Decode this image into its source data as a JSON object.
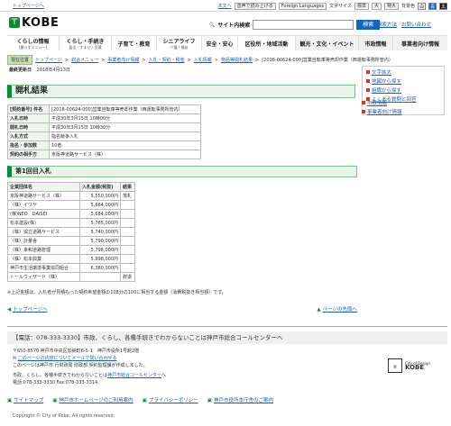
{
  "top": {
    "skip_link": "トップページへ",
    "tools": {
      "main_text": "本文へ",
      "read_aloud": "音声で読み上げる",
      "language": "Foreign Languages",
      "font_size_label": "文字サイズ",
      "font_normal": "標準",
      "font_large": "大",
      "font_xlarge": "特大",
      "bg_color_label": "背景色",
      "bg_white": "白",
      "bg_blue": "青",
      "bg_black": "黒"
    }
  },
  "logo": {
    "text": "KOBE"
  },
  "search": {
    "label": "サイト内検索",
    "placeholder": "",
    "button": "検索"
  },
  "header_links": {
    "search_help": "検索方法",
    "contact": "お問い合わせ"
  },
  "gnav": [
    {
      "title": "くらしの情報",
      "sub": "[暮らすメニュー]"
    },
    {
      "title": "くらし・手続き",
      "sub": "届出・すまい・交通"
    },
    {
      "title": "子育て・教育",
      "sub": ""
    },
    {
      "title": "シニアライフ",
      "sub": "介護・福祉"
    },
    {
      "title": "安全・安心",
      "sub": ""
    },
    {
      "title": "区役所・地域活動",
      "sub": ""
    },
    {
      "title": "観光・文化・イベント",
      "sub": ""
    },
    {
      "title": "市政情報",
      "sub": ""
    },
    {
      "title": "事業者向け情報",
      "sub": ""
    }
  ],
  "breadcrumb": {
    "here_label": "現在位置",
    "items": [
      "トップページ",
      "総合メニュー",
      "事業者向け情報",
      "入札・契約・税金",
      "入札情報",
      "物品等開札結果"
    ],
    "current": "[2018-00624-000]営業自転車等売却作業（西運転事務所管内）"
  },
  "updated": {
    "label": "最終更新日",
    "date": "2018年4月13日"
  },
  "right_links": [
    "文字拡大",
    "地図から探す",
    "組織から探す",
    "よくある質問と回答"
  ],
  "right_links2": [
    "市政情報",
    "事業者向け情報"
  ],
  "result": {
    "heading": "開札結果",
    "info_rows": [
      {
        "key": "[契約番号] 件名",
        "value": "[2018-00624-000]営業自転車等売却作業（西運転事務所管内）"
      },
      {
        "key": "入札日時",
        "value": "平成30年3月15日 10時00分"
      },
      {
        "key": "開札日時",
        "value": "平成30年3月15日 10時30分"
      },
      {
        "key": "入札方式",
        "value": "指名競争入札"
      },
      {
        "key": "指名・参加数",
        "value": "10者"
      },
      {
        "key": "契約の相手方",
        "value": "京阪神道路サービス（株）"
      }
    ],
    "round_heading": "第1回目入札",
    "bid_headers": [
      "企業団体名",
      "入札金額(税抜)",
      "結果"
    ],
    "bids": [
      {
        "name": "京阪神道路サービス（株）",
        "amount": "5,550,000円",
        "result": "落札"
      },
      {
        "name": "（株）イワヤ",
        "amount": "5,664,000円",
        "result": ""
      },
      {
        "name": "(株)NEO　DAISEI",
        "amount": "5,684,000円",
        "result": ""
      },
      {
        "name": "松本建設(株)",
        "amount": "5,765,000円",
        "result": ""
      },
      {
        "name": "（株）協立道路サービス",
        "amount": "5,740,000円",
        "result": ""
      },
      {
        "name": "（株）計量舎",
        "amount": "5,790,000円",
        "result": ""
      },
      {
        "name": "（株）幸和道路管理",
        "amount": "5,798,000円",
        "result": ""
      },
      {
        "name": "（株）松本興業",
        "amount": "5,898,000円",
        "result": ""
      },
      {
        "name": "神戸市生活環境事業協同組合",
        "amount": "6,380,000円",
        "result": ""
      },
      {
        "name": "トールウィザード（株）",
        "amount": "",
        "result": "辞退"
      }
    ],
    "note": "※上記金額は、入札者が見積もった契約希望金額の108分の100に相当する金額（消費税抜き相当額）です。"
  },
  "page_links": {
    "top": "トップページへ",
    "page_top": "ページの先頭へ"
  },
  "footer": {
    "call_center": "【電話：078-333-3330】市政、くらし、各種手続きでわからないことは神戸市総合コールセンターへ",
    "address": "〒650-8570 神戸市中央区加納町6-5-1　神戸市役所1号館2階",
    "contact_link": "このページの内容についてメールで問い合わせる",
    "editor": "このページは神戸市 行財政局 財政部 契約監理課が作成しました。",
    "call_note_text": "市政、くらし、各種手続きでわからないことは",
    "call_note_link": "神戸市総合コールセンター",
    "call_note_tail": "へ",
    "tel": "電話:078-333-3330 Fax:078-333-3314",
    "seal": {
      "line1": "City of Design",
      "line2": "KOBE"
    }
  },
  "bottom_links": [
    "サイトマップ",
    "神戸市ホームページのご利用案内",
    "プライバシーポリシー",
    "神戸市役所本庁舎のご案内"
  ],
  "copyright": "Copyright © City of Kobe. All rights reserved."
}
